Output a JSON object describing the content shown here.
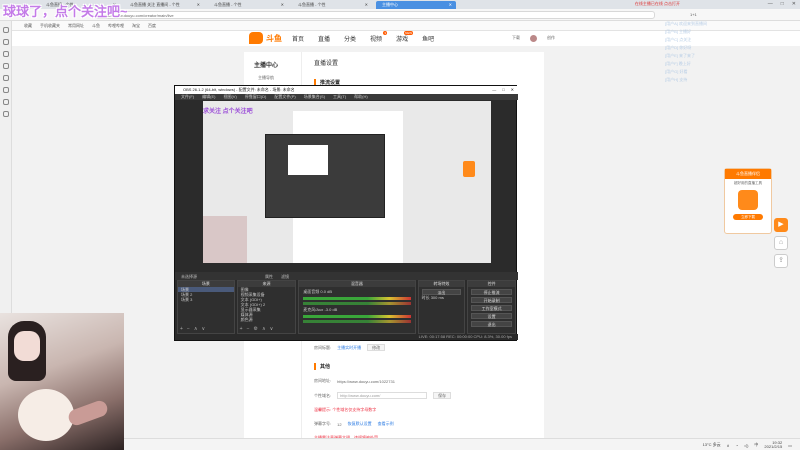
{
  "browser": {
    "tabs": [
      {
        "label": "斗鱼直播 - 个性",
        "active": false
      },
      {
        "label": "斗鱼直播 关注 直播间 - 个性",
        "active": false
      },
      {
        "label": "斗鱼直播 - 个性",
        "active": false
      },
      {
        "label": "斗鱼直播 - 个性",
        "active": false
      },
      {
        "label": "主播中心",
        "active": true
      }
    ],
    "tab_right_text": "在线主播已在线 点击打开",
    "address": "https://www.douyu.com/creator/main/live",
    "addr_right": "1+1",
    "bookmarks": [
      "收藏",
      "手机收藏夹",
      "常用网址",
      "斗鱼",
      "哔哩哔哩",
      "淘宝",
      "百度"
    ]
  },
  "header": {
    "logo": "斗鱼",
    "nav": [
      "首页",
      "直播",
      "分类",
      "视频",
      "游戏",
      "鱼吧"
    ],
    "nav_badges": {
      "视频": "3",
      "游戏": "NEW"
    },
    "right": [
      "下载",
      "创作"
    ]
  },
  "sidebar": {
    "title": "主播中心",
    "items": [
      "主播导航"
    ]
  },
  "main": {
    "title": "直播设置",
    "section1": "推流设置",
    "room_label": "房间标题:",
    "room_value": "主播实时开播",
    "room_btn": "修改",
    "section2": "其他",
    "room_addr_label": "房间地址:",
    "room_addr_value": "https://www.douyu.com/1022731",
    "custom_label": "个性域名:",
    "custom_value": "http://www.douyu.com/",
    "custom_btn": "保存",
    "custom_hint": "温馨提示: 个性域名仅支持字母数字",
    "barrage_label": "弹幕字号:",
    "barrage_value": "12",
    "barrage_link1": "恢复默认设置",
    "barrage_link2": "查看示例",
    "warning": "主播需注意弹幕文明，违规将被处罚"
  },
  "obs": {
    "title": "OBS 26.1.2 (64-bit, windows) - 配置文件: 未命名 - 场景: 未命名",
    "menu": [
      "文件(F)",
      "编辑(E)",
      "视图(V)",
      "停靠窗口(D)",
      "配置文件(P)",
      "场景集合(S)",
      "工具(T)",
      "帮助(H)"
    ],
    "preview_text": "求关注 点个关注吧",
    "status_left": "未选择源",
    "status_mid": [
      "属性",
      "滤镜"
    ],
    "docks": {
      "scenes": {
        "title": "场景",
        "items": [
          "场景",
          "场景 2",
          "场景 3"
        ]
      },
      "sources": {
        "title": "来源",
        "items": [
          "图像",
          "视频采集设备",
          "文本 (GDI+)",
          "文本 (GDI+) 2",
          "显示器采集",
          "媒体源",
          "颜色源"
        ]
      },
      "mixer": {
        "title": "混音器",
        "channels": [
          {
            "name": "桌面音频",
            "db": "0.0 dB"
          },
          {
            "name": "麦克风/Aux",
            "db": "-3.0 dB"
          }
        ]
      },
      "transitions": {
        "title": "转场特效",
        "type": "淡出",
        "duration_label": "时长",
        "duration": "300 ms"
      },
      "controls": {
        "title": "控件",
        "buttons": [
          "停止推流",
          "开始录制",
          "工作室模式",
          "设置",
          "退出"
        ]
      }
    },
    "footer": "LIVE: 00:17:58  REC: 00:00:00  CPU: 8.3%, 30.00 fps"
  },
  "promo": {
    "title": "斗鱼直播伴侣",
    "sub": "超好用的直播工具",
    "btn": "立即下载"
  },
  "chat_ghost": [
    "[用户A] 欢迎来到直播间",
    "[用户B] 主播好",
    "[用户C] 点关注",
    "[用户D] 你好呀",
    "[用户E] 来了来了",
    "[用户F] 晚上好",
    "[用户G] 好看",
    "[用户H] 支持"
  ],
  "overlay": {
    "text": "球球了，点个关注吧~"
  },
  "taskbar": {
    "weather": "13°C 多云",
    "ime": "中",
    "time": "19:32",
    "date": "2021/2/15"
  }
}
